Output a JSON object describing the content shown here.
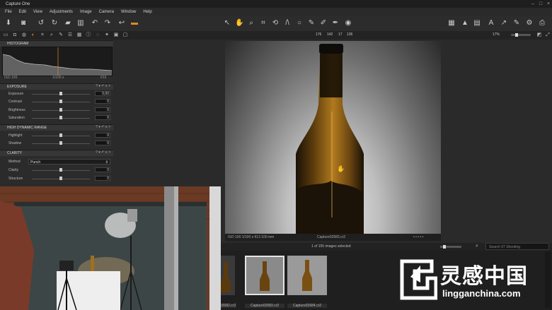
{
  "app": {
    "title": "Capture One"
  },
  "menu": [
    "File",
    "Edit",
    "View",
    "Adjustments",
    "Image",
    "Camera",
    "Window",
    "Help"
  ],
  "toolbar": {
    "left_icons": [
      "import-icon",
      "capture-icon",
      "rotate-left-icon",
      "rotate-right-icon",
      "folder-icon",
      "trash-icon",
      "undo-icon",
      "redo-icon",
      "reset-icon",
      "export-icon"
    ],
    "center_icons": [
      "select-icon",
      "pan-icon",
      "loupe-icon",
      "crop-icon",
      "straighten-icon",
      "keystone-icon",
      "spot-icon",
      "mask-brush-icon",
      "color-picker-icon",
      "white-balance-icon",
      "exposure-warning-icon"
    ],
    "right_icons": [
      "view-grid-icon",
      "warning-icon",
      "proof-icon",
      "text-icon",
      "arrow-icon",
      "brush-icon",
      "settings-icon",
      "print-icon",
      "zoom-icon"
    ]
  },
  "coords": {
    "r": "176",
    "g": "142",
    "b": "17",
    "l": "136"
  },
  "zoom_text": "17%",
  "panels": {
    "histogram": {
      "title": "HISTOGRAM",
      "iso": "ISO 100",
      "shutter": "1/100 s",
      "aperture": "f/13"
    },
    "exposure": {
      "title": "EXPOSURE",
      "rows": [
        {
          "label": "Exposure",
          "value": "0,00"
        },
        {
          "label": "Contrast",
          "value": "0"
        },
        {
          "label": "Brightness",
          "value": "0"
        },
        {
          "label": "Saturation",
          "value": "0"
        }
      ]
    },
    "hdr": {
      "title": "HIGH DYNAMIC RANGE",
      "rows": [
        {
          "label": "Highlight",
          "value": "0"
        },
        {
          "label": "Shadow",
          "value": "0"
        }
      ]
    },
    "clarity": {
      "title": "CLARITY",
      "method_label": "Method",
      "method_value": "Punch",
      "rows": [
        {
          "label": "Clarity",
          "value": "0"
        },
        {
          "label": "Structure",
          "value": "0"
        }
      ]
    }
  },
  "viewer": {
    "info_left": "ISO 100  1/100 s  f/13  100 mm",
    "info_file": "Capture02683.cr2"
  },
  "status": {
    "count": "1 of 155 images selected"
  },
  "search": {
    "placeholder": "Search 07 Shooting"
  },
  "filmstrip": [
    {
      "label": "02682.cr2"
    },
    {
      "label": "Capture02683.cr2"
    },
    {
      "label": "Capture02684.cr2"
    }
  ],
  "watermark": {
    "brand": "灵感中国",
    "url": "lingganchina.com"
  },
  "colors": {
    "accent": "#e08a1e",
    "panel": "#2b2b2b",
    "background": "#262626"
  }
}
